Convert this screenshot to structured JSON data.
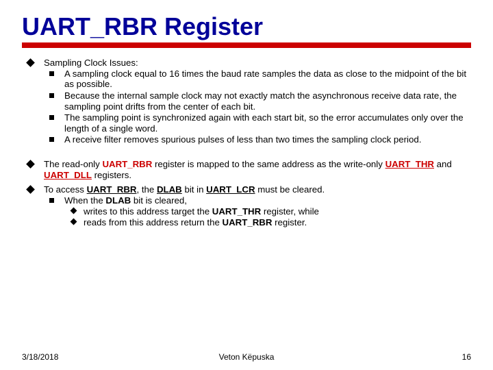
{
  "title": "UART_RBR Register",
  "lvl1": [
    {
      "text": "Sampling Clock Issues:"
    },
    {
      "parts": [
        {
          "t": "The read-only "
        },
        {
          "t": "UART_RBR",
          "cls": "red"
        },
        {
          "t": " register is mapped to the same address as the write-only "
        },
        {
          "t": "UART_THR",
          "cls": "red u"
        },
        {
          "t": " and "
        },
        {
          "t": "UART_DLL",
          "cls": "red u"
        },
        {
          "t": " registers."
        }
      ]
    },
    {
      "parts": [
        {
          "t": "To access "
        },
        {
          "t": "UART_RBR",
          "cls": "b u"
        },
        {
          "t": ", the "
        },
        {
          "t": "DLAB",
          "cls": "b u"
        },
        {
          "t": " bit in "
        },
        {
          "t": "UART_LCR",
          "cls": "b u"
        },
        {
          "t": " must be cleared."
        }
      ]
    }
  ],
  "sampling_sub": [
    "A sampling clock equal to 16 times the baud rate samples the data as close to the midpoint of the bit as possible.",
    "Because the internal sample clock may not exactly match the asynchronous receive data rate, the sampling point drifts from the center of each bit.",
    "The sampling point is synchronized again with each start bit, so the error accumulates only over the length of a single word.",
    "A receive filter removes spurious pulses of less than two times the sampling clock period."
  ],
  "dlab_sub": {
    "intro_parts": [
      {
        "t": "When the "
      },
      {
        "t": "DLAB",
        "cls": "b"
      },
      {
        "t": " bit is cleared,"
      }
    ],
    "items": [
      [
        {
          "t": "writes to this address target the "
        },
        {
          "t": "UART_THR",
          "cls": "b"
        },
        {
          "t": " register, while"
        }
      ],
      [
        {
          "t": "reads from this address return the "
        },
        {
          "t": "UART_RBR",
          "cls": "b"
        },
        {
          "t": " register."
        }
      ]
    ]
  },
  "footer": {
    "date": "3/18/2018",
    "author": "Veton Këpuska",
    "page": "16"
  }
}
